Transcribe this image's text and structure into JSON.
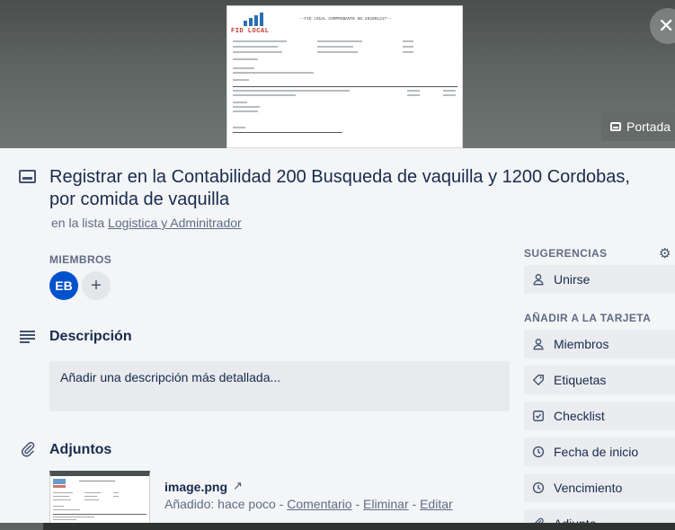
{
  "cover": {
    "doc_brand": "FID LOCAL",
    "doc_heading": "--FID LOCAL COMPROBANTE NO.202001217--",
    "portada_label": "Portada",
    "close_glyph": "✕"
  },
  "card": {
    "title": "Registrar en la Contabilidad 200 Busqueda de vaquilla y 1200 Cordobas, por comida de vaquilla",
    "in_list_prefix": "en la lista",
    "list_name": "Logistica y Adminitrador"
  },
  "members": {
    "label": "MIEMBROS",
    "avatar_initials": "EB",
    "add_glyph": "+"
  },
  "description": {
    "heading": "Descripción",
    "placeholder": "Añadir una descripción más detallada..."
  },
  "attachments": {
    "heading": "Adjuntos",
    "file_name": "image.png",
    "open_glyph": "↗",
    "added_text": "Añadido: hace poco",
    "sep": " - ",
    "comment_link": "Comentario",
    "delete_link": "Eliminar",
    "edit_link": "Editar"
  },
  "sidebar": {
    "suggestions_label": "SUGERENCIAS",
    "join_label": "Unirse",
    "add_to_card_label": "AÑADIR A LA TARJETA",
    "members_label": "Miembros",
    "labels_label": "Etiquetas",
    "checklist_label": "Checklist",
    "start_date_label": "Fecha de inicio",
    "due_label": "Vencimiento",
    "attachment_label": "Adjunto"
  },
  "colors": {
    "avatar": "#0052cc",
    "text": "#172b4d",
    "muted": "#5e6c84",
    "button_bg": "#ebecf0"
  }
}
